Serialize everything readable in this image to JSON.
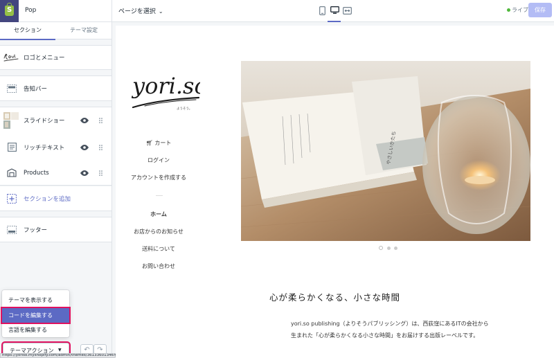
{
  "topbar": {
    "theme_name": "Pop",
    "page_select_label": "ページを選択",
    "live_label": "ライブ",
    "save_label": "保存"
  },
  "sidebar": {
    "tabs": [
      {
        "label": "セクション",
        "active": true
      },
      {
        "label": "テーマ設定",
        "active": false
      }
    ],
    "rows": [
      {
        "label": "ロゴとメニュー",
        "icon": "logo-thumbnail-icon"
      },
      {
        "label": "告知バー",
        "icon": "announcement-bar-icon"
      },
      {
        "label": "スライドショー",
        "icon": "slideshow-thumbnail-icon"
      },
      {
        "label": "リッチテキスト",
        "icon": "rich-text-icon"
      },
      {
        "label": "Products",
        "icon": "collection-icon"
      },
      {
        "label": "セクションを追加",
        "icon": "add-section-icon"
      },
      {
        "label": "フッター",
        "icon": "footer-icon"
      }
    ],
    "theme_menu": [
      {
        "label": "テーマを表示する"
      },
      {
        "label": "コードを編集する",
        "highlighted": true
      },
      {
        "label": "言語を編集する"
      }
    ],
    "theme_actions_label": "テーマアクション",
    "status_url": "https://yoriso.myshopify.com/admin/themes/36133601346を新規タブで開く"
  },
  "preview": {
    "brand_text": "yori.so",
    "brand_subtext": "ようそう。",
    "nav_items": [
      "カート",
      "ログイン",
      "アカウントを作成する",
      "ホーム",
      "お店からのお知らせ",
      "送料について",
      "お問い合わせ"
    ],
    "hero_book_spine": "やさしいかたち",
    "headline": "心が柔らかくなる、小さな時間",
    "paragraph": "yori.so publishing（よりそうパブリッシング）は、西荻窪にあるITの会社から生まれた「心が柔らかくなる小さな時間」をお届けする出版レーベルです。",
    "slide_count": 3,
    "active_slide": 1
  },
  "colors": {
    "accent": "#5c6ac4",
    "highlight_outline": "#e0115f",
    "save_disabled": "#b3bcf5",
    "live": "#50b83c",
    "shopify_nav": "#43467f"
  }
}
